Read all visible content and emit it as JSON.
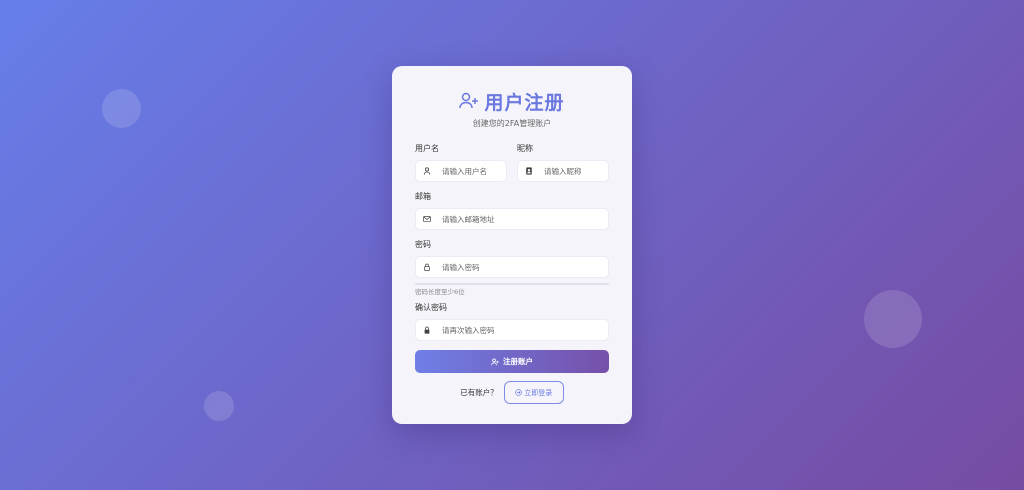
{
  "colors": {
    "accent": "#6a78e0",
    "gradient_start": "#667eea",
    "gradient_end": "#764ba2",
    "card_bg": "#f5f4fb"
  },
  "header": {
    "icon": "user-plus-icon",
    "title": "用户注册",
    "subtitle": "创建您的2FA管理账户"
  },
  "form": {
    "username": {
      "label": "用户名",
      "placeholder": "请输入用户名",
      "icon": "person-icon"
    },
    "nickname": {
      "label": "昵称",
      "placeholder": "请输入昵称",
      "icon": "id-badge-icon"
    },
    "email": {
      "label": "邮箱",
      "placeholder": "请输入邮箱地址",
      "icon": "envelope-icon"
    },
    "password": {
      "label": "密码",
      "placeholder": "请输入密码",
      "icon": "lock-outline-icon",
      "hint": "密码长度至少6位"
    },
    "confirm": {
      "label": "确认密码",
      "placeholder": "请再次输入密码",
      "icon": "lock-filled-icon"
    },
    "submit_label": "注册账户"
  },
  "footer": {
    "question": "已有账户？",
    "login_label": "立即登录"
  }
}
